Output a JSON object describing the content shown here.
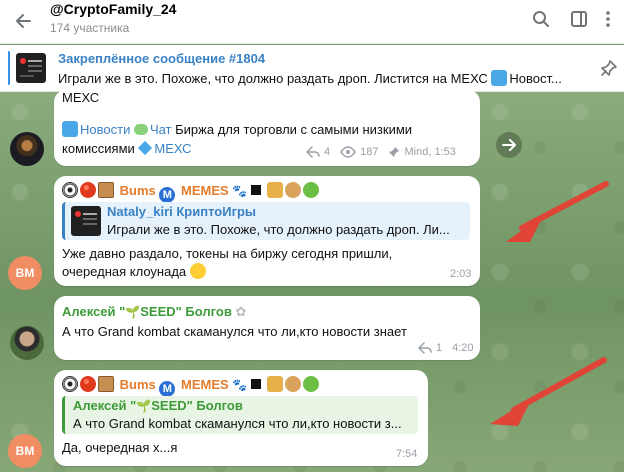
{
  "header": {
    "title": "@CryptoFamily_24",
    "subtitle": "174 участника"
  },
  "pinned": {
    "title": "Закреплённое сообщение #1804",
    "text": "Играли же в это. Похоже, что должно раздать дроп. Листится на МЕХС",
    "text_tail": "Новост..."
  },
  "messages": {
    "m1": {
      "text_top": "МЕХС",
      "line1_link1": "Новости",
      "line1_link2": "Чат",
      "line1_text": " Биржа для торговли с самыми низкими",
      "line2_text": "комиссиями",
      "line2_link": "МЕХС",
      "replies": "4",
      "views": "187",
      "author": "Mind, 1:53"
    },
    "m2": {
      "sender_prefix": "Bums",
      "sender_suffix": "MEMES",
      "quote_name": "Nataly_kiri КриптоИгры",
      "quote_text": "Играли же в это. Похоже, что должно раздать дроп. Ли...",
      "text_line1": "Уже давно раздало, токены на биржу сегодня пришли,",
      "text_line2": "очередная клоунада",
      "time": "2:03",
      "avatar": "BM"
    },
    "m3": {
      "sender_a": "Алексей \"",
      "sender_b": "SEED\" Болгов",
      "text": "А что Grand kombat скаманулся что ли,кто новости знает",
      "replies": "1",
      "time": "4:20"
    },
    "m4": {
      "sender_prefix": "Bums",
      "sender_suffix": "MEMES",
      "quote_name_a": "Алексей \"",
      "quote_name_b": "SEED\" Болгов",
      "quote_text": "А что Grand kombat скаманулся что ли,кто новости з...",
      "text": "Да, очередная х...я",
      "time": "7:54",
      "avatar": "BM"
    }
  },
  "colors": {
    "accent": "#3390ec",
    "link": "#3a82c4",
    "sender_orange": "#e57d2d",
    "sender_green": "#3d9b39",
    "avatar_bm": "#f08d62",
    "arrow_red": "#e04436"
  }
}
